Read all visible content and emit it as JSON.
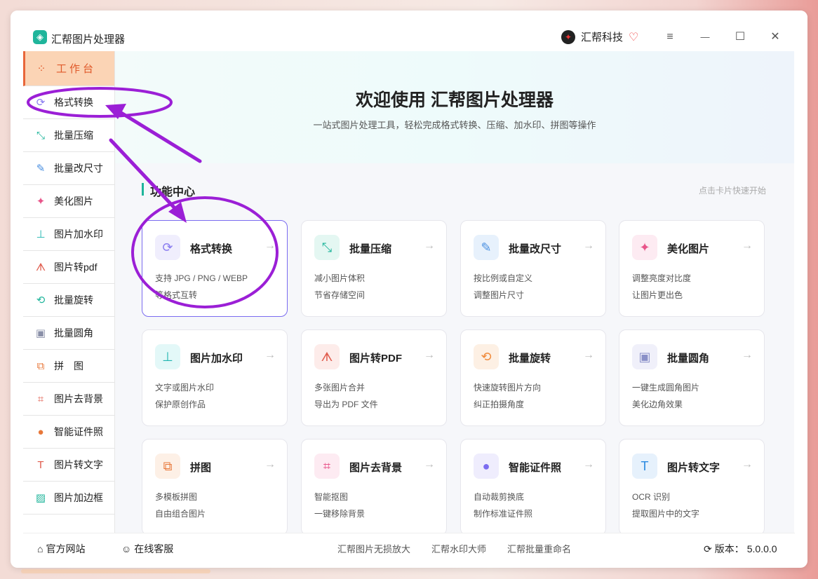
{
  "app": {
    "title": "汇帮图片处理器",
    "logo_icon": "app-logo-icon"
  },
  "brand": {
    "name": "汇帮科技",
    "logo_icon": "brand-logo-icon",
    "vip_icon": "vip-heart-icon"
  },
  "window_controls": {
    "menu": "≡",
    "minimize": "—",
    "maximize": "☐",
    "close": "✕"
  },
  "sidebar": {
    "items": [
      {
        "label": "工作台",
        "icon": "grid-icon",
        "glyph": "⁘",
        "color": "#e05a2b"
      },
      {
        "label": "格式转换",
        "icon": "convert-icon",
        "glyph": "⟳",
        "color": "#8a7cf0"
      },
      {
        "label": "批量压缩",
        "icon": "compress-icon",
        "glyph": "⤡",
        "color": "#1fb59b"
      },
      {
        "label": "批量改尺寸",
        "icon": "resize-icon",
        "glyph": "✎",
        "color": "#4a8fe0"
      },
      {
        "label": "美化图片",
        "icon": "beautify-icon",
        "glyph": "✦",
        "color": "#e8558a"
      },
      {
        "label": "图片加水印",
        "icon": "watermark-icon",
        "glyph": "⊥",
        "color": "#1fb5b0"
      },
      {
        "label": "图片转pdf",
        "icon": "pdf-icon",
        "glyph": "ᗑ",
        "color": "#e05a4b"
      },
      {
        "label": "批量旋转",
        "icon": "rotate-icon",
        "glyph": "⟲",
        "color": "#1fb59b"
      },
      {
        "label": "批量圆角",
        "icon": "round-corner-icon",
        "glyph": "▣",
        "color": "#8a90a8"
      },
      {
        "label": "拼　图",
        "icon": "puzzle-icon",
        "glyph": "⧉",
        "color": "#e8783a"
      },
      {
        "label": "图片去背景",
        "icon": "crop-icon",
        "glyph": "⌗",
        "color": "#e05a4b"
      },
      {
        "label": "智能证件照",
        "icon": "person-icon",
        "glyph": "●",
        "color": "#e8783a"
      },
      {
        "label": "图片转文字",
        "icon": "text-icon",
        "glyph": "T",
        "color": "#e05a4b"
      },
      {
        "label": "图片加边框",
        "icon": "frame-icon",
        "glyph": "▨",
        "color": "#1fb59b"
      }
    ]
  },
  "hero": {
    "title": "欢迎使用 汇帮图片处理器",
    "subtitle": "一站式图片处理工具，轻松完成格式转换、压缩、加水印、拼图等操作"
  },
  "section": {
    "title": "功能中心",
    "hint": "点击卡片快速开始"
  },
  "cards": [
    {
      "title": "格式转换",
      "d1": "支持 JPG / PNG / WEBP",
      "d2": "等格式互转",
      "icon": "convert-icon",
      "glyph": "⟳",
      "color": "#8a7cf0",
      "bg": "#f0eefd",
      "arrow": "→"
    },
    {
      "title": "批量压缩",
      "d1": "减小图片体积",
      "d2": "节省存储空间",
      "icon": "compress-icon",
      "glyph": "⤡",
      "color": "#1fb59b",
      "bg": "#e4f7f2",
      "arrow": "→"
    },
    {
      "title": "批量改尺寸",
      "d1": "按比例或自定义",
      "d2": "调整图片尺寸",
      "icon": "resize-icon",
      "glyph": "✎",
      "color": "#4a8fe0",
      "bg": "#e7f1fc",
      "arrow": "→"
    },
    {
      "title": "美化图片",
      "d1": "调整亮度对比度",
      "d2": "让图片更出色",
      "icon": "beautify-icon",
      "glyph": "✦",
      "color": "#e8558a",
      "bg": "#fdebf2",
      "arrow": "→"
    },
    {
      "title": "图片加水印",
      "d1": "文字或图片水印",
      "d2": "保护原创作品",
      "icon": "watermark-icon",
      "glyph": "⊥",
      "color": "#1fb5b0",
      "bg": "#e3f8f8",
      "arrow": "→"
    },
    {
      "title": "图片转PDF",
      "d1": "多张图片合并",
      "d2": "导出为 PDF 文件",
      "icon": "pdf-icon",
      "glyph": "ᗑ",
      "color": "#e05a4b",
      "bg": "#fdecea",
      "arrow": "→"
    },
    {
      "title": "批量旋转",
      "d1": "快速旋转图片方向",
      "d2": "纠正拍摄角度",
      "icon": "rotate-icon",
      "glyph": "⟲",
      "color": "#f08a3a",
      "bg": "#fdf0e4",
      "arrow": "→"
    },
    {
      "title": "批量圆角",
      "d1": "一键生成圆角图片",
      "d2": "美化边角效果",
      "icon": "round-corner-icon",
      "glyph": "▣",
      "color": "#8a90c8",
      "bg": "#f0f0fa",
      "arrow": "→"
    },
    {
      "title": "拼图",
      "d1": "多模板拼图",
      "d2": "自由组合图片",
      "icon": "puzzle-icon",
      "glyph": "⧉",
      "color": "#e8783a",
      "bg": "#fdf0e6",
      "arrow": "→"
    },
    {
      "title": "图片去背景",
      "d1": "智能抠图",
      "d2": "一键移除背景",
      "icon": "crop-icon",
      "glyph": "⌗",
      "color": "#e8558a",
      "bg": "#fdebf2",
      "arrow": "→"
    },
    {
      "title": "智能证件照",
      "d1": "自动裁剪换底",
      "d2": "制作标准证件照",
      "icon": "person-icon",
      "glyph": "●",
      "color": "#7b6cf0",
      "bg": "#efedfd",
      "arrow": "→"
    },
    {
      "title": "图片转文字",
      "d1": "OCR 识别",
      "d2": "提取图片中的文字",
      "icon": "text-icon",
      "glyph": "T",
      "color": "#2a8ae0",
      "bg": "#e6f1fc",
      "arrow": "→"
    }
  ],
  "footer": {
    "website": "官方网站",
    "support": "在线客服",
    "links": [
      "汇帮图片无损放大",
      "汇帮水印大师",
      "汇帮批量重命名"
    ],
    "version_label": "版本：",
    "version": "5.0.0.0"
  },
  "colors": {
    "accent": "#1fb59b",
    "active_bg": "#fbd4b5",
    "active_text": "#e05a2b",
    "annotation": "#9b1fd6",
    "selected_border": "#7b6cf0"
  }
}
